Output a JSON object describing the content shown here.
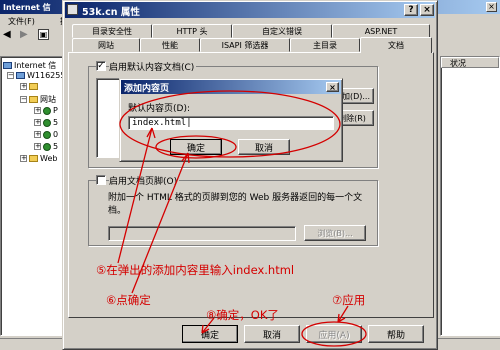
{
  "parent_window": {
    "title": "Internet 信",
    "menu": [
      "文件(F)",
      "操"
    ],
    "tree": {
      "root": "Internet 信",
      "server": "W116255",
      "items": [
        "",
        "网站",
        "P",
        "5",
        "0",
        "5",
        "Web"
      ]
    },
    "status_col": "状况"
  },
  "dialog": {
    "title": "53k.cn 属性",
    "close_glyph": "×",
    "help_glyph": "?",
    "tabs_row1": [
      "目录安全性",
      "HTTP 头",
      "自定义错误",
      "ASP.NET"
    ],
    "tabs_row2": [
      "网站",
      "性能",
      "ISAPI 筛选器",
      "主目录",
      "文档"
    ],
    "enable_default": {
      "label": "启用默认内容文档(C)",
      "checked": true
    },
    "side_buttons": [
      "添加(D)...",
      "删除(R)"
    ],
    "footer": {
      "label": "启用文档页脚(O)",
      "checked": false,
      "description": "附加一个 HTML 格式的页脚到您的 Web 服务器返回的每一个文档。",
      "browse": "浏览(B)..."
    },
    "buttons": {
      "ok": "确定",
      "cancel": "取消",
      "apply": "应用(A)",
      "help": "帮助"
    }
  },
  "add_dialog": {
    "title": "添加内容页",
    "close_glyph": "×",
    "label": "默认内容页(D):",
    "value": "index.html",
    "ok": "确定",
    "cancel": "取消"
  },
  "annotations": {
    "step5": "⑤在弹出的添加内容里输入index.html",
    "step6": "⑥点确定",
    "step8": "⑧确定，OK了",
    "step7": "⑦应用"
  },
  "colors": {
    "annotation": "#d40000",
    "title_bar": "#0a246a",
    "title_bar_end": "#a6caf0",
    "face": "#d4d0c8"
  }
}
